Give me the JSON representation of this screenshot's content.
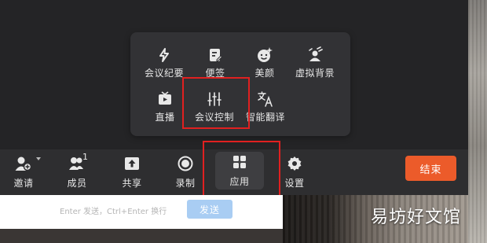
{
  "apps_panel": {
    "items": [
      {
        "label": "会议纪要",
        "icon": "lightning-icon"
      },
      {
        "label": "便签",
        "icon": "note-edit-icon"
      },
      {
        "label": "美颜",
        "icon": "beauty-face-icon"
      },
      {
        "label": "虚拟背景",
        "icon": "virtual-background-icon"
      },
      {
        "label": "直播",
        "icon": "live-tv-icon"
      },
      {
        "label": "会议控制",
        "icon": "sliders-icon"
      },
      {
        "label": "智能翻译",
        "icon": "translate-icon"
      }
    ]
  },
  "toolbar": {
    "invite_label": "邀请",
    "members_label": "成员",
    "members_count": "1",
    "share_label": "共享",
    "record_label": "录制",
    "apps_label": "应用",
    "settings_label": "设置",
    "end_label": "结束"
  },
  "chat": {
    "hint": "Enter 发送，Ctrl+Enter 换行",
    "send_label": "发送"
  },
  "watermark": "易坊好文馆",
  "colors": {
    "end_button": "#ec5b2a",
    "highlight_box": "#e02020",
    "send_button": "#a9cdf3"
  }
}
